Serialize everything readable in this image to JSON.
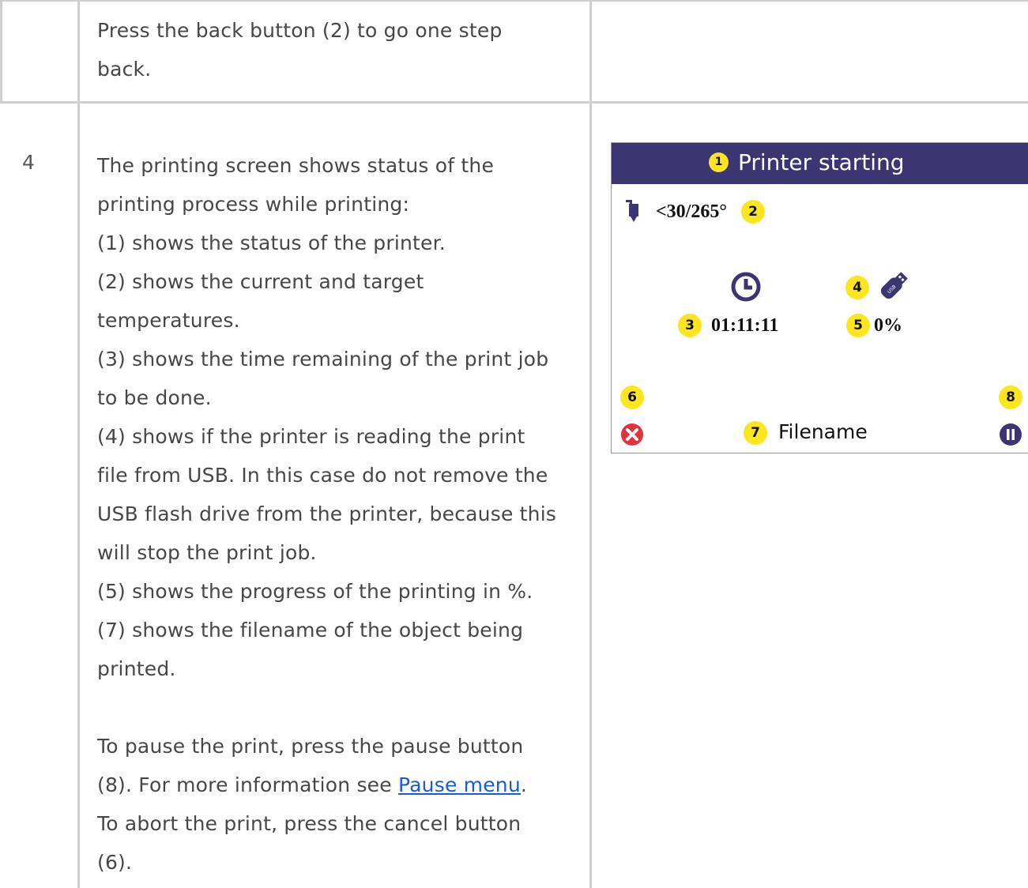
{
  "row_prev": {
    "text_lines": [
      "Press the back button (2) to go one step",
      "back."
    ]
  },
  "row4": {
    "number": "4",
    "paragraph1": [
      "The printing screen shows status of the",
      "printing process while printing:",
      "(1) shows the status of the printer.",
      "(2) shows the current and target",
      "temperatures.",
      "(3) shows the time remaining of the print job",
      "to be done.",
      "(4) shows if the printer is reading the print",
      "file from USB. In this case do not remove the",
      "USB flash drive from the printer, because this",
      "will stop the print job.",
      "(5) shows the progress of the printing in %.",
      "(7) shows the filename of the object being",
      "printed."
    ],
    "pause_line1": "To pause the print, press the pause button",
    "pause_line2_pre": "(8). For more information see ",
    "pause_link": "Pause menu",
    "pause_line2_post": ".",
    "abort_line1": "To abort the print, press the cancel button",
    "abort_line2": "(6)."
  },
  "printer_screen": {
    "title": "Printer starting",
    "temperature": "<30/265°",
    "time_remaining": "01:11:11",
    "progress": "0%",
    "filename": "Filename",
    "header_color": "#3b3571",
    "badge_color": "#fde51f",
    "cancel_color": "#e2323a",
    "badges": {
      "b1": "1",
      "b2": "2",
      "b3": "3",
      "b4": "4",
      "b5": "5",
      "b6": "6",
      "b7": "7",
      "b8": "8"
    },
    "icons": [
      "nozzle-icon",
      "clock-icon",
      "usb-drive-icon",
      "cancel-icon",
      "pause-icon"
    ]
  }
}
